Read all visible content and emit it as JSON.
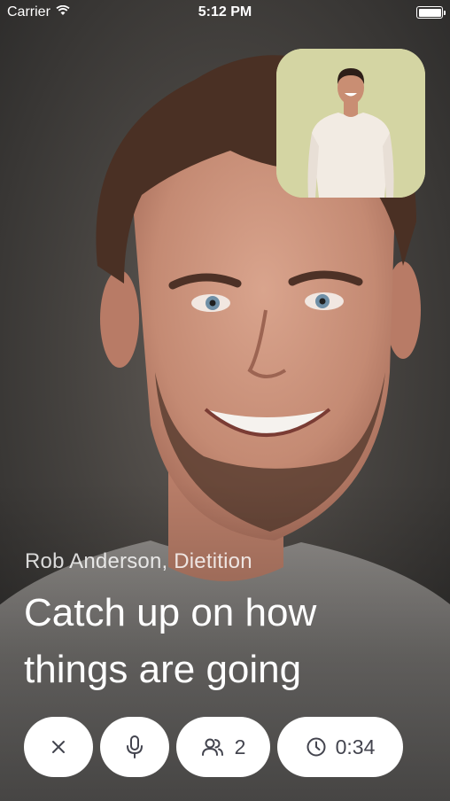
{
  "status_bar": {
    "carrier": "Carrier",
    "time": "5:12 PM",
    "wifi_icon": "wifi-icon",
    "battery_icon": "battery-icon"
  },
  "call": {
    "caller_name": "Rob Anderson, Dietition",
    "headline": "Catch up on how things are going"
  },
  "controls": {
    "end_icon": "close-icon",
    "mic_icon": "microphone-icon",
    "participants_icon": "people-icon",
    "participants_count": "2",
    "timer_icon": "clock-icon",
    "timer": "0:34"
  },
  "colors": {
    "self_view_bg": "#d4d5a3",
    "control_bg": "#ffffff",
    "control_fg": "#43444e"
  }
}
